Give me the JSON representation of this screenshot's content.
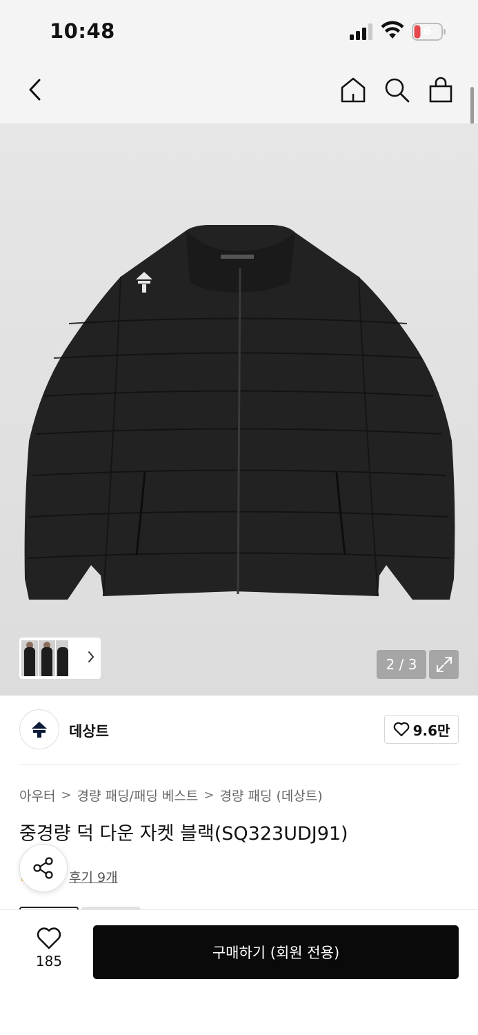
{
  "status_bar": {
    "time": "10:48",
    "battery_level": "6",
    "icons": [
      "cellular-signal-icon",
      "wifi-icon",
      "battery-icon"
    ]
  },
  "nav": {
    "icons": [
      "chevron-left-icon",
      "home-icon",
      "search-icon",
      "shopping-bag-icon"
    ]
  },
  "gallery": {
    "counter": "2 / 3",
    "current_index": 2,
    "total": 3,
    "icons": [
      "chevron-right-icon",
      "expand-icon"
    ]
  },
  "brand": {
    "name": "데상트",
    "like_count": "9.6만",
    "logo_icon": "descente-logo-icon"
  },
  "breadcrumb": {
    "items": [
      "아우터",
      "경량 패딩/패딩 베스트",
      "경량 패딩 (데상트)"
    ],
    "separator": ">"
  },
  "product": {
    "title": "중경량 덕 다운 자켓 블랙(SQ323UDJ91)",
    "review_link": "후기 9개"
  },
  "bottom_bar": {
    "wish_count": "185",
    "buy_label": "구매하기 (회원 전용)"
  },
  "colors": {
    "primary_button": "#0a0a0a",
    "background": "#ffffff",
    "header_bg": "#f4f4f4",
    "battery_low": "#e5484d"
  }
}
